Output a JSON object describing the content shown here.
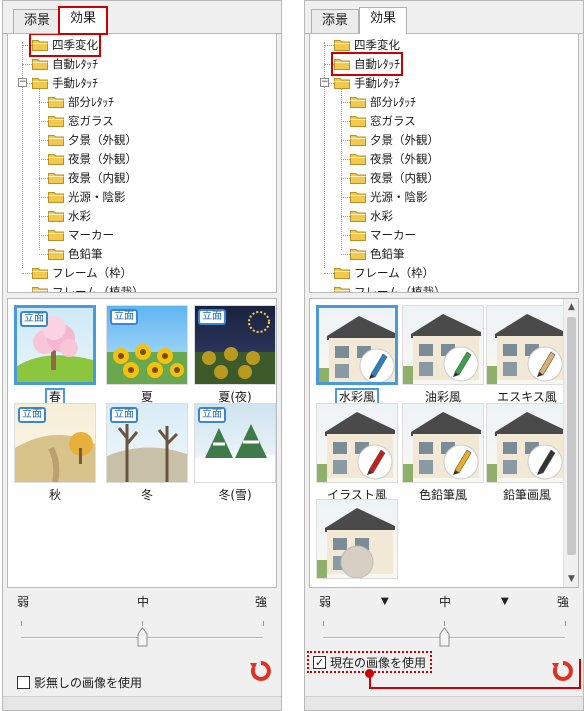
{
  "left_panel": {
    "tabs": [
      "添景",
      "効果"
    ],
    "tree": [
      "四季変化",
      "自動ﾚﾀｯﾁ",
      "手動ﾚﾀｯﾁ",
      "部分ﾚﾀｯﾁ",
      "窓ガラス",
      "夕景（外観）",
      "夜景（外観）",
      "夜景（内観）",
      "光源・陰影",
      "水彩",
      "マーカー",
      "色鉛筆",
      "フレーム（枠）",
      "フレーム（植栽）"
    ],
    "badge": "立面",
    "thumbs": [
      "春",
      "夏",
      "夏(夜)",
      "秋",
      "冬",
      "冬(雪)"
    ],
    "slider": {
      "weak": "弱",
      "mid": "中",
      "strong": "強"
    },
    "checkbox_label": "影無しの画像を使用",
    "checkbox_checked": false
  },
  "right_panel": {
    "tabs": [
      "添景",
      "効果"
    ],
    "tree": [
      "四季変化",
      "自動ﾚﾀｯﾁ",
      "手動ﾚﾀｯﾁ",
      "部分ﾚﾀｯﾁ",
      "窓ガラス",
      "夕景（外観）",
      "夜景（外観）",
      "夜景（内観）",
      "光源・陰影",
      "水彩",
      "マーカー",
      "色鉛筆",
      "フレーム（枠）",
      "フレーム（植栽）"
    ],
    "thumbs": [
      "水彩風",
      "油彩風",
      "エスキス風",
      "イラスト風",
      "色鉛筆風",
      "鉛筆画風",
      ""
    ],
    "slider": {
      "weak": "弱",
      "mid": "中",
      "strong": "強"
    },
    "checkbox_label": "現在の画像を使用",
    "checkbox_checked": true,
    "check_mark": "✓"
  },
  "colors": {
    "highlight_red": "#cc0000",
    "select_blue": "#4b9ad8",
    "folder": "#f2c94c",
    "reset": "#e03020"
  }
}
